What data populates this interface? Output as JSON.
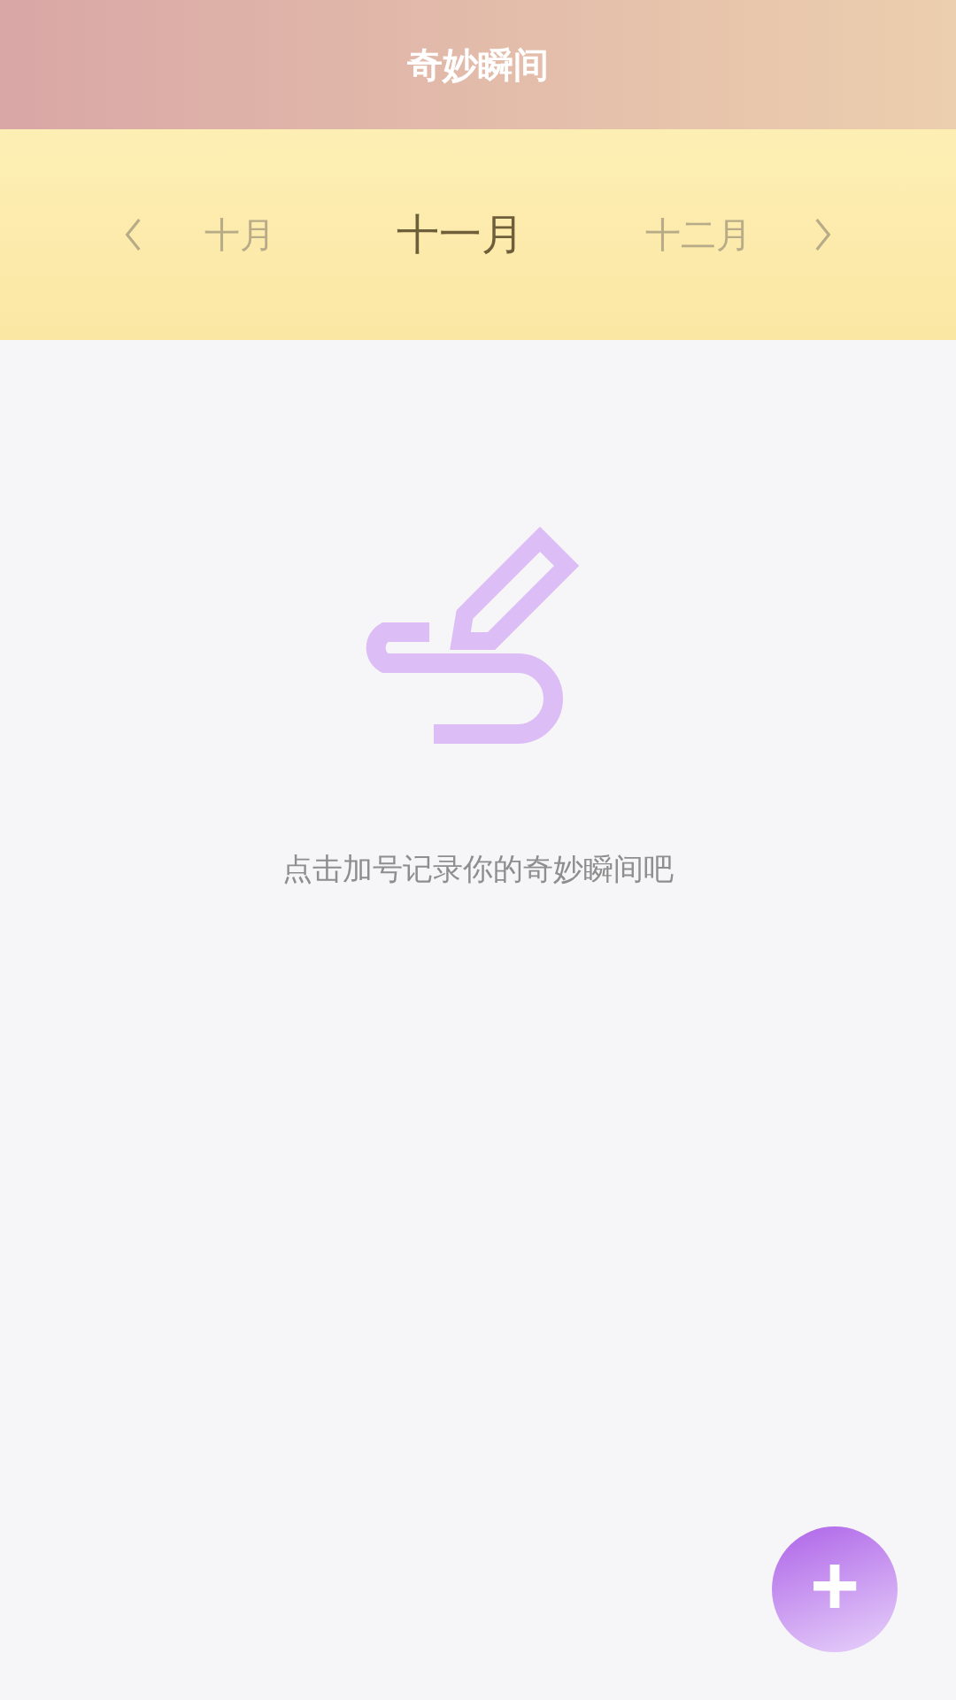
{
  "header": {
    "title": "奇妙瞬间"
  },
  "months": [
    {
      "label": "十月",
      "selected": false
    },
    {
      "label": "十一月",
      "selected": true
    },
    {
      "label": "十二月",
      "selected": false
    }
  ],
  "empty_state": {
    "message": "点击加号记录你的奇妙瞬间吧"
  },
  "add_button": {
    "label": "+"
  }
}
